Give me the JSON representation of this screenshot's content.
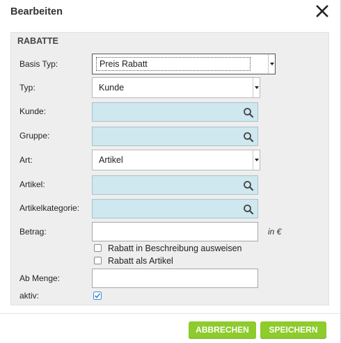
{
  "dialog": {
    "title": "Bearbeiten",
    "close_icon": "close-icon"
  },
  "section": {
    "title": "RABATTE"
  },
  "fields": {
    "basis_typ": {
      "label": "Basis Typ:",
      "value": "Preis Rabatt"
    },
    "typ": {
      "label": "Typ:",
      "value": "Kunde"
    },
    "kunde": {
      "label": "Kunde:",
      "value": ""
    },
    "gruppe": {
      "label": "Gruppe:",
      "value": ""
    },
    "art": {
      "label": "Art:",
      "value": "Artikel"
    },
    "artikel": {
      "label": "Artikel:",
      "value": ""
    },
    "artikelkategorie": {
      "label": "Artikelkategorie:",
      "value": ""
    },
    "betrag": {
      "label": "Betrag:",
      "value": "",
      "unit": "in €"
    },
    "rabatt_beschreibung": {
      "label": "Rabatt in Beschreibung ausweisen",
      "checked": false
    },
    "rabatt_artikel": {
      "label": "Rabatt als Artikel",
      "checked": false
    },
    "ab_menge": {
      "label": "Ab Menge:",
      "value": ""
    },
    "aktiv": {
      "label": "aktiv:",
      "checked": true
    }
  },
  "buttons": {
    "cancel": "ABBRECHEN",
    "save": "SPEICHERN"
  },
  "colors": {
    "accent_green": "#8ecb2c",
    "lookup_bg": "#cfe7ee",
    "panel_bg": "#eeeeee",
    "checkbox_check": "#3c86d8"
  }
}
